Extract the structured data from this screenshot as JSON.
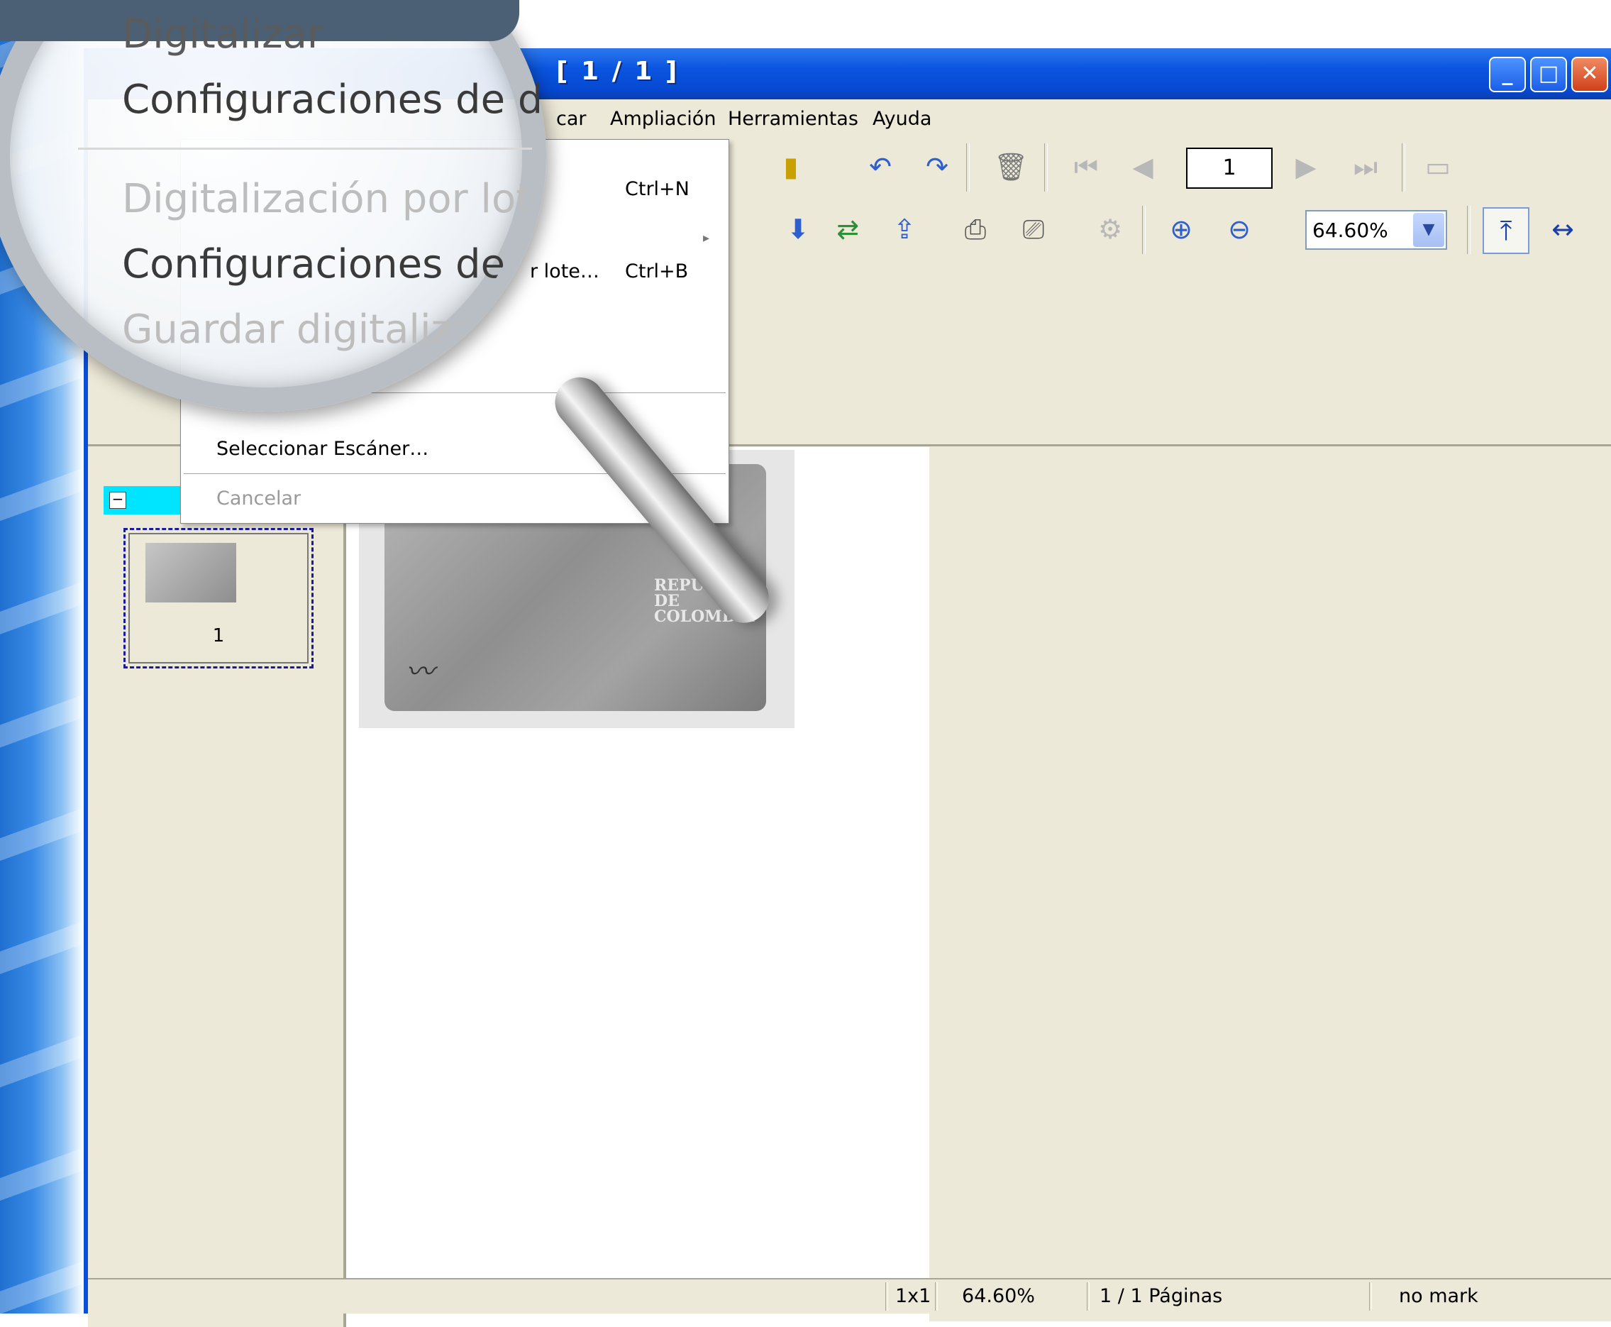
{
  "window": {
    "title": "[ 1 / 1 ]",
    "minimize_glyph": "_",
    "maximize_glyph": "□",
    "close_glyph": "✕"
  },
  "menubar": {
    "items": [
      "car",
      "Ampliación",
      "Herramientas",
      "Ayuda"
    ]
  },
  "toolbar": {
    "page_value": "1",
    "zoom_value": "64.60%",
    "zoom_arrow": "▼",
    "icons": [
      "rotate-left-icon",
      "rotate-right-icon",
      "delete-icon",
      "first-page-icon",
      "prev-page-icon",
      "next-page-icon",
      "last-page-icon",
      "page-view-icon",
      "scan-icon",
      "scan-select-icon",
      "settings-icon",
      "zoom-in-icon",
      "zoom-out-icon",
      "fit-height-icon",
      "fit-width-icon",
      "actual-size-icon",
      "search-icon"
    ]
  },
  "dropdown": {
    "shortcut_new": "Ctrl+N",
    "item_batch_tail": "r lote…",
    "shortcut_batch": "Ctrl+B",
    "item_select_scanner": "Seleccionar Escáner…",
    "item_cancel": "Cancelar",
    "submenu_arrow": "▸"
  },
  "magnifier": {
    "line1": "Digitalizar",
    "line2": "Configuraciones de dig",
    "line3": "Digitalización por lote",
    "line4": "Configuraciones de di",
    "line5": "Guardar digitalizaci…"
  },
  "thumbnails": {
    "collapse_glyph": "−",
    "page_number": "1"
  },
  "document": {
    "card_text": "REPUBLICA DE COLOMBIA",
    "card_text_lines": [
      "REPUBLICA DE",
      "COLOMBIA"
    ]
  },
  "statusbar": {
    "grid": "1x1",
    "zoom": "64.60%",
    "pages": "1 / 1 Páginas",
    "mark": "no mark"
  }
}
